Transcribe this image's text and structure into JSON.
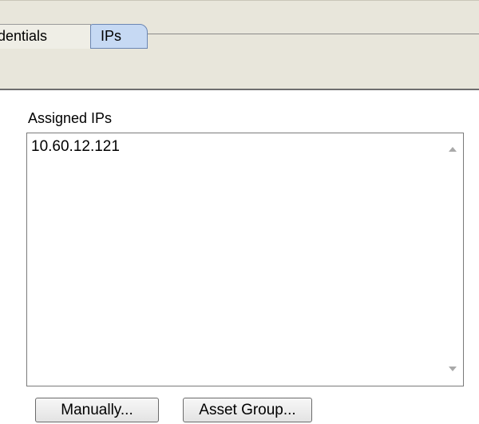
{
  "tabs": [
    {
      "label": "dentials",
      "selected": false
    },
    {
      "label": "IPs",
      "selected": true
    }
  ],
  "assigned_ips": {
    "label": "Assigned IPs",
    "items": [
      "10.60.12.121"
    ]
  },
  "buttons": {
    "manually": "Manually...",
    "asset_group": "Asset Group..."
  },
  "colors": {
    "tab_band": "#e8e6db",
    "selected_tab": "#c6d9f3"
  },
  "icons": {
    "scroll_up": "scroll-up-arrow-icon",
    "scroll_down": "scroll-down-arrow-icon"
  }
}
